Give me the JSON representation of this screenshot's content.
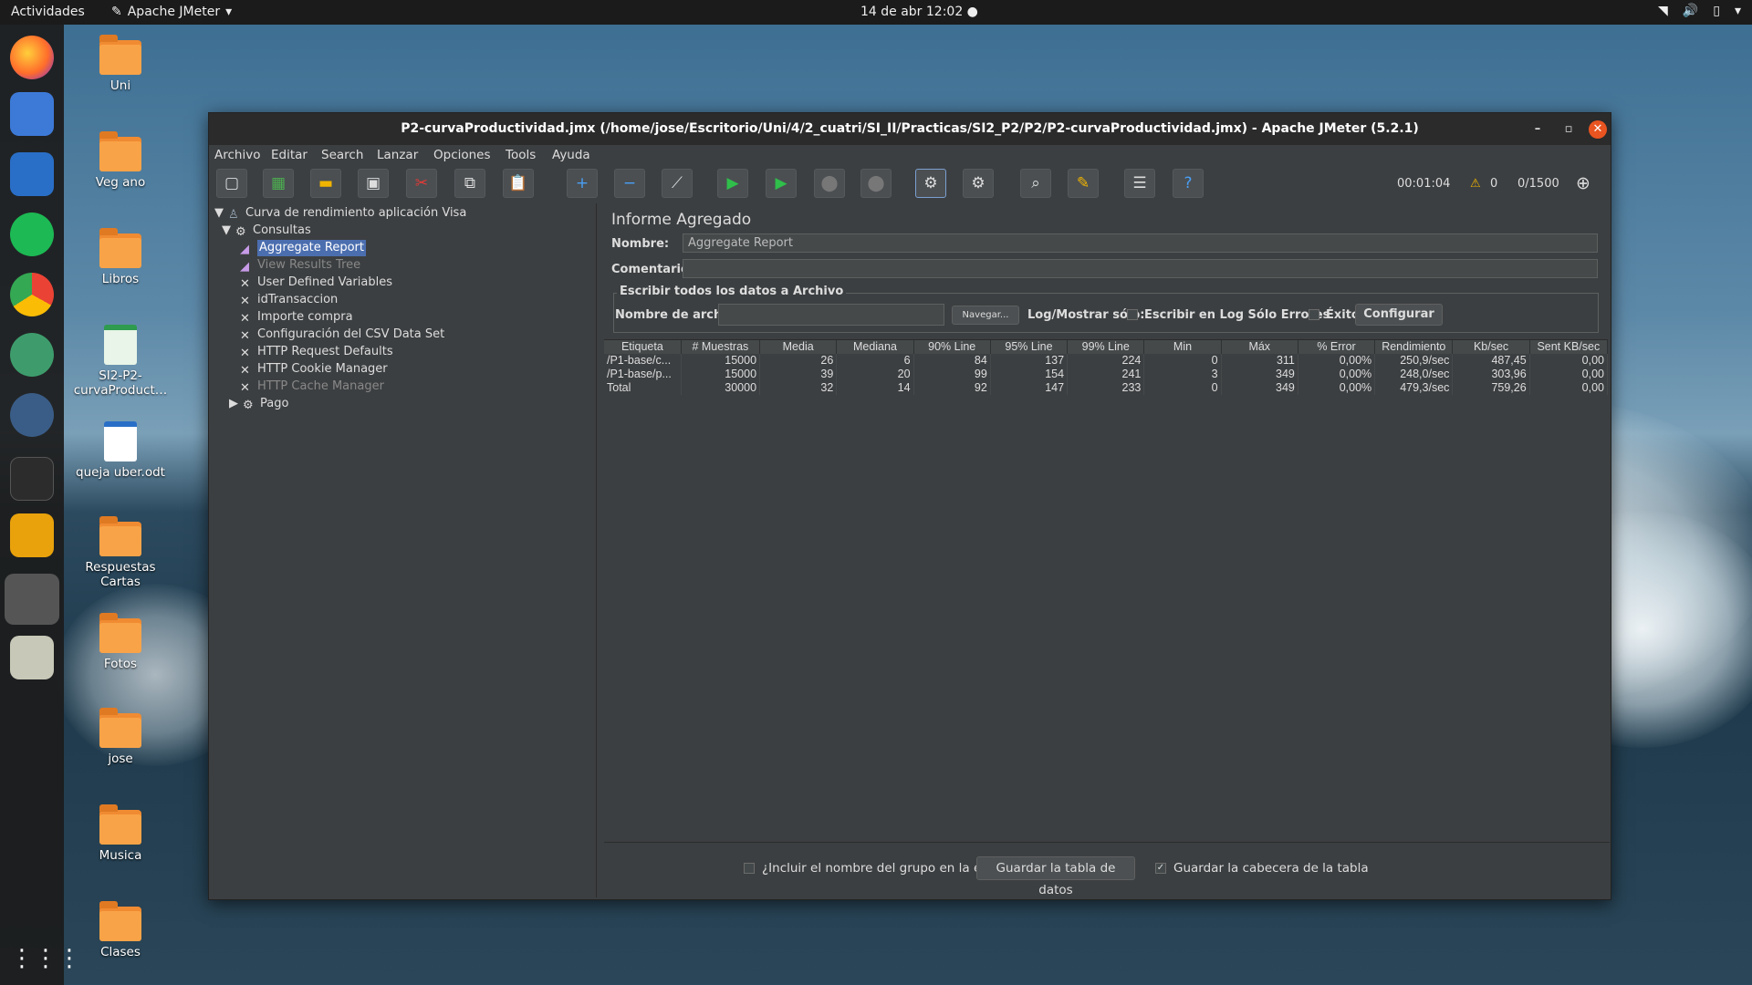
{
  "topbar": {
    "activities": "Actividades",
    "app_name": "Apache JMeter",
    "clock": "14 de abr  12:02"
  },
  "desktop_icons": [
    {
      "label": "Uni"
    },
    {
      "label": "Veg ano"
    },
    {
      "label": "Libros"
    },
    {
      "label": "SI2-P2-\ncurvaProduct…"
    },
    {
      "label": "queja uber.odt"
    },
    {
      "label": "Respuestas Cartas"
    },
    {
      "label": "Fotos"
    },
    {
      "label": "jose"
    },
    {
      "label": "Musica"
    },
    {
      "label": "Clases"
    }
  ],
  "window": {
    "title": "P2-curvaProductividad.jmx (/home/jose/Escritorio/Uni/4/2_cuatri/SI_II/Practicas/SI2_P2/P2/P2-curvaProductividad.jmx) - Apache JMeter (5.2.1)"
  },
  "menu": [
    "Archivo",
    "Editar",
    "Search",
    "Lanzar",
    "Opciones",
    "Tools",
    "Ayuda"
  ],
  "toolbar": {
    "elapsed": "00:01:04",
    "warnings": "0",
    "threads": "0/1500"
  },
  "tree": [
    {
      "label": "Curva de rendimiento aplicación Visa",
      "icon": "test-plan-icon"
    },
    {
      "label": "Consultas",
      "icon": "gear-icon"
    },
    {
      "label": "Aggregate Report",
      "icon": "chart-icon"
    },
    {
      "label": "View Results Tree",
      "icon": "chart-icon"
    },
    {
      "label": "User Defined Variables",
      "icon": "scissors-icon"
    },
    {
      "label": "idTransaccion",
      "icon": "scissors-icon"
    },
    {
      "label": "Importe compra",
      "icon": "scissors-icon"
    },
    {
      "label": "Configuración del CSV Data Set",
      "icon": "scissors-icon"
    },
    {
      "label": "HTTP Request Defaults",
      "icon": "scissors-icon"
    },
    {
      "label": "HTTP Cookie Manager",
      "icon": "scissors-icon"
    },
    {
      "label": "HTTP Cache Manager",
      "icon": "scissors-icon"
    },
    {
      "label": "Pago",
      "icon": "gear-icon"
    }
  ],
  "report": {
    "title": "Informe Agregado",
    "name_label": "Nombre:",
    "name_value": "Aggregate Report",
    "comments_label": "Comentarios",
    "comments_value": "",
    "group_title": "Escribir todos los datos a Archivo",
    "filename_label": "Nombre de archivo",
    "filename_value": "",
    "browse_label": "Navegar...",
    "log_label": "Log/Mostrar sólo:",
    "errors_label": "Escribir en Log Sólo Errores",
    "success_label": "Éxitos",
    "configure_label": "Configurar",
    "columns": [
      "Etiqueta",
      "# Muestras",
      "Media",
      "Mediana",
      "90% Line",
      "95% Line",
      "99% Line",
      "Min",
      "Máx",
      "% Error",
      "Rendimiento",
      "Kb/sec",
      "Sent KB/sec"
    ],
    "rows": [
      [
        "/P1-base/c...",
        "15000",
        "26",
        "6",
        "84",
        "137",
        "224",
        "0",
        "311",
        "0,00%",
        "250,9/sec",
        "487,45",
        "0,00"
      ],
      [
        "/P1-base/p...",
        "15000",
        "39",
        "20",
        "99",
        "154",
        "241",
        "3",
        "349",
        "0,00%",
        "248,0/sec",
        "303,96",
        "0,00"
      ],
      [
        "Total",
        "30000",
        "32",
        "14",
        "92",
        "147",
        "233",
        "0",
        "349",
        "0,00%",
        "479,3/sec",
        "759,26",
        "0,00"
      ]
    ],
    "include_group_label": "¿Incluir el nombre del grupo en la etiqueta?",
    "save_table_label": "Guardar la tabla de datos",
    "save_header_label": "Guardar la cabecera de la tabla"
  }
}
